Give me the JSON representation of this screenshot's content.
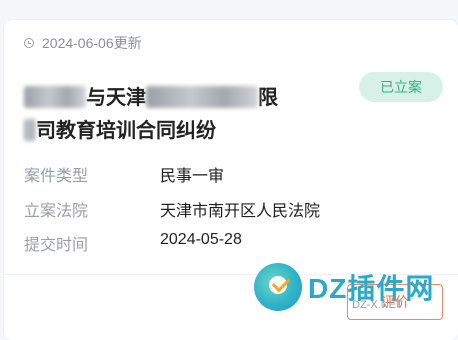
{
  "card": {
    "updated": "2024-06-06更新",
    "title_line1": "与天津",
    "title_line1b": "限",
    "title_line2": "司教育培训合同纠纷",
    "status": "已立案",
    "fields": [
      {
        "label": "案件类型",
        "value": "民事一审"
      },
      {
        "label": "立案法院",
        "value": "天津市南开区人民法院"
      },
      {
        "label": "提交时间",
        "value": "2024-05-28"
      }
    ],
    "evaluate_label": "评价"
  },
  "watermark": {
    "text": "DZ插件网",
    "url": "DZ-X.NET"
  },
  "colors": {
    "status_bg": "#d8f1e8",
    "status_text": "#3aaa82",
    "evaluate": "#e0744f"
  }
}
